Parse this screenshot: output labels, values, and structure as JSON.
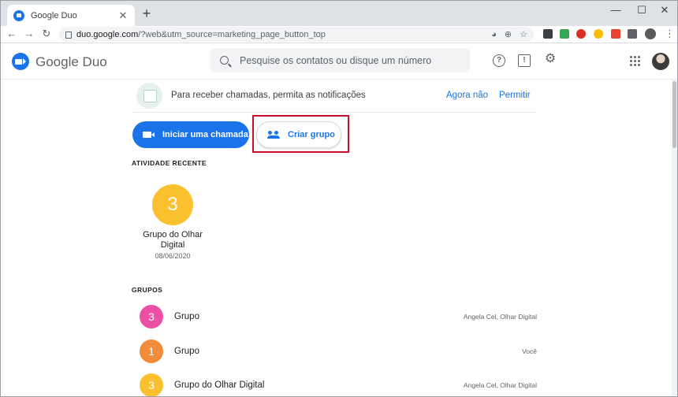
{
  "browser": {
    "tab_title": "Google Duo",
    "tab_close": "✕",
    "new_tab": "+",
    "window_controls": [
      "—",
      "☐",
      "✕"
    ],
    "url_host": "duo.google.com",
    "url_path": "/?web&utm_source=marketing_page_button_top"
  },
  "app": {
    "brand": "Google Duo",
    "search_placeholder": "Pesquise os contatos ou disque um número",
    "help_icon": "?",
    "feedback_icon": "!",
    "settings_icon": "⚙"
  },
  "notification": {
    "text": "Para receber chamadas, permita as notificações",
    "dismiss": "Agora não",
    "allow": "Permitir"
  },
  "actions": {
    "start_call": "Iniciar uma chamada",
    "create_group": "Criar grupo"
  },
  "recent": {
    "section_title": "ATIVIDADE RECENTE",
    "items": [
      {
        "badge": "3",
        "name": "Grupo do Olhar Digital",
        "date": "08/06/2020",
        "color": "#fbc02d"
      }
    ]
  },
  "groups": {
    "section_title": "GRUPOS",
    "items": [
      {
        "badge": "3",
        "name": "Grupo",
        "members": "Angela Cel, Olhar Digital",
        "color": "#ec4fa3"
      },
      {
        "badge": "1",
        "name": "Grupo",
        "members": "Você",
        "color": "#f28b3a"
      },
      {
        "badge": "3",
        "name": "Grupo do Olhar Digital",
        "members": "Angela Cel, Olhar Digital",
        "color": "#fbc02d"
      }
    ]
  },
  "colors": {
    "accent": "#1a73e8",
    "highlight_box": "#c8102e"
  }
}
